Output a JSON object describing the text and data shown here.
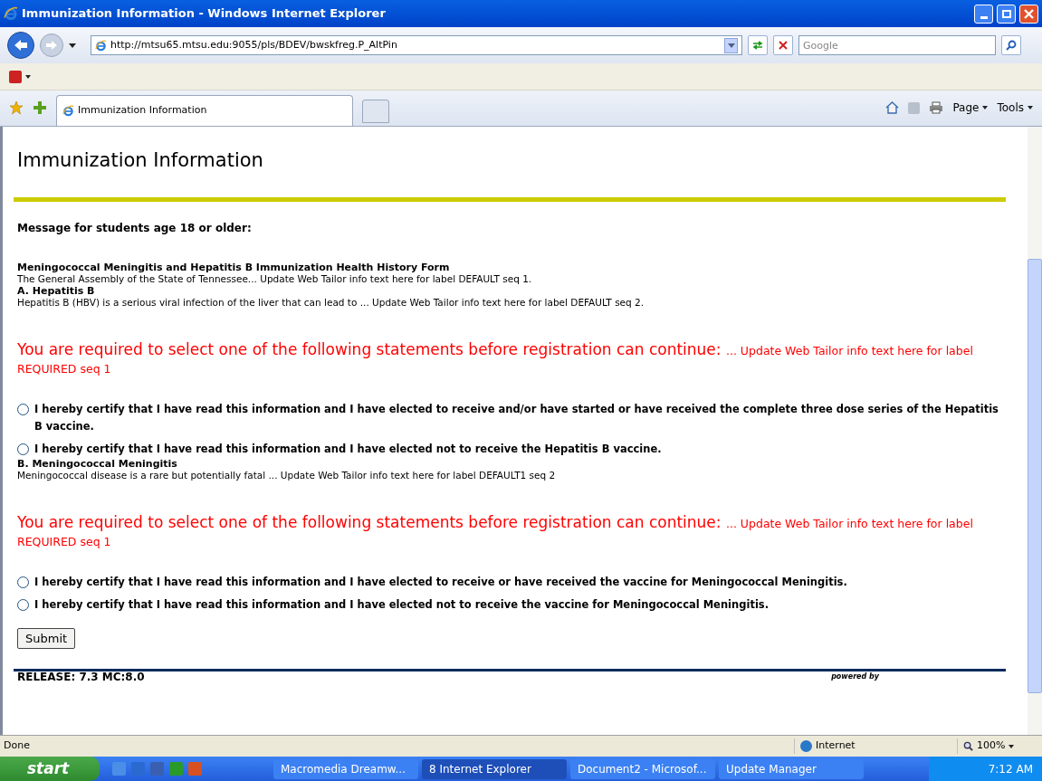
{
  "window": {
    "title": "Immunization Information - Windows Internet Explorer"
  },
  "address": {
    "url": "http://mtsu65.mtsu.edu:9055/pls/BDEV/bwskfreg.P_AltPin"
  },
  "search": {
    "placeholder": "Google"
  },
  "tabs": [
    {
      "label": "Immunization Information",
      "selected": true
    },
    {
      "selected": false
    }
  ],
  "command_bar": [
    "Page",
    "Tools"
  ],
  "page": {
    "heading": "Immunization Information",
    "blocks": [
      {
        "kind": "message",
        "text": "Message for students age 18 or older:"
      },
      {
        "kind": "title",
        "text": "Meningococcal Meningitis and Hepatitis B Immunization Health History Form"
      },
      {
        "kind": "text",
        "text": "The General Assembly of the State of Tennessee... Update Web Tailor info text here for label DEFAULT seq 1."
      },
      {
        "kind": "title",
        "text": "A. Hepatitis B"
      },
      {
        "kind": "text",
        "text": "Hepatitis B (HBV) is a serious viral infection of the liver that can lead to ... Update Web Tailor info text here for label DEFAULT seq 2."
      },
      {
        "kind": "required",
        "text": "You are required to select one of the following statements before registration can continue:",
        "note": "... Update Web Tailor info text here for label REQUIRED seq 1"
      },
      {
        "kind": "radio",
        "selected": false,
        "text": "I hereby certify that I have read this information and I have elected to receive and/or have started or have received the complete three dose series of the Hepatitis B vaccine."
      },
      {
        "kind": "radio",
        "selected": false,
        "text": "I hereby certify that I have read this information and I have elected not to receive the Hepatitis B vaccine."
      },
      {
        "kind": "title",
        "text": "B. Meningococcal Meningitis"
      },
      {
        "kind": "text",
        "text": "Meningococcal disease is a rare but potentially fatal ... Update Web Tailor info text here for label DEFAULT1 seq 2"
      },
      {
        "kind": "required",
        "text": "You are required to select one of the following statements before registration can continue:",
        "note": "... Update Web Tailor info text here for label REQUIRED seq 1"
      },
      {
        "kind": "radio",
        "selected": false,
        "text": "I hereby certify that I have read this information and I have elected to receive or have received the vaccine for Meningococcal Meningitis."
      },
      {
        "kind": "radio",
        "selected": false,
        "text": "I hereby certify that I have read this information and I have elected not to receive the vaccine for Meningococcal Meningitis."
      }
    ],
    "submit": "Submit",
    "release": "RELEASE: 7.3 MC:8.0",
    "powered_by": "powered by"
  },
  "status_bar": {
    "text": "Done",
    "zone": "Internet",
    "zoom": "100%"
  },
  "taskbar": {
    "start": "start",
    "tasks": [
      {
        "label": "Macromedia Dreamw...",
        "selected": false
      },
      {
        "label": "8 Internet Explorer",
        "selected": true
      },
      {
        "label": "Document2 - Microsof...",
        "selected": false
      },
      {
        "label": "Update Manager",
        "selected": false
      }
    ],
    "clock": "7:12 AM"
  }
}
